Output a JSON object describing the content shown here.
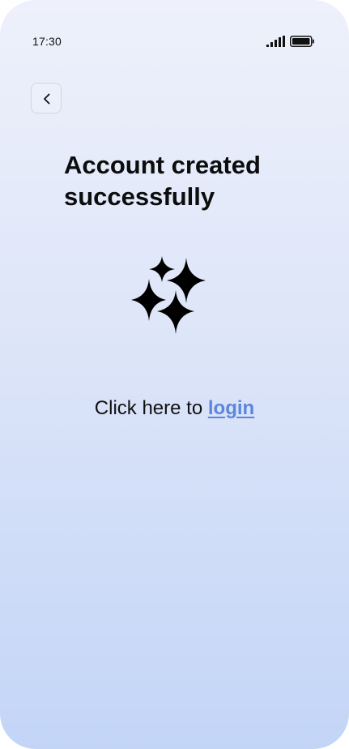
{
  "status_bar": {
    "time": "17:30",
    "signal_icon": "cellular-signal-icon",
    "battery_icon": "battery-full-icon"
  },
  "header": {
    "back_icon": "chevron-left-icon"
  },
  "main": {
    "title": "Account created successfully",
    "illustration_icon": "sparkles-icon",
    "login_prompt": "Click here to",
    "login_link": "login"
  },
  "colors": {
    "background_top": "#eef1fb",
    "background_bottom": "#c3d5f7",
    "link": "#5b86de",
    "text": "#0d0d0d"
  }
}
